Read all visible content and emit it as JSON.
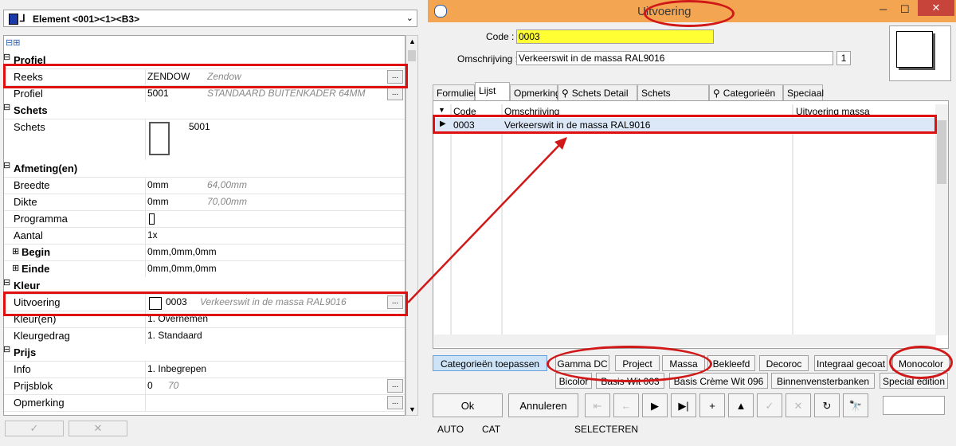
{
  "left": {
    "element_combo": "Element <001><1><B3>",
    "grid_header": "⊟⊞",
    "rows": [
      {
        "label": "Profiel",
        "kind": "cat"
      },
      {
        "label": "Reeks",
        "value": "ZENDOW",
        "hint": "Zendow",
        "btn": true
      },
      {
        "label": "Profiel",
        "value": "5001",
        "hint": "STANDAARD BUITENKADER 64MM",
        "btn": true
      },
      {
        "label": "Schets",
        "kind": "cat"
      },
      {
        "label": "Schets",
        "value": "5001"
      },
      {
        "label": "Afmeting(en)",
        "kind": "cat"
      },
      {
        "label": "Breedte",
        "value": "0mm",
        "hint": "64,00mm"
      },
      {
        "label": "Dikte",
        "value": "0mm",
        "hint": "70,00mm"
      },
      {
        "label": "Programma",
        "value": ""
      },
      {
        "label": "Aantal",
        "value": "1x"
      },
      {
        "label": "Begin",
        "value": "0mm,0mm,0mm"
      },
      {
        "label": "Einde",
        "value": "0mm,0mm,0mm"
      },
      {
        "label": "Kleur",
        "kind": "cat"
      },
      {
        "label": "Uitvoering",
        "value": "0003",
        "hint": "Verkeerswit in de massa RAL9016",
        "btn": true
      },
      {
        "label": "Kleur(en)",
        "value": "1. Overnemen"
      },
      {
        "label": "Kleurgedrag",
        "value": "1. Standaard"
      },
      {
        "label": "Prijs",
        "kind": "cat"
      },
      {
        "label": "Info",
        "value": "1. Inbegrepen"
      },
      {
        "label": "Prijsblok",
        "value": "0",
        "hint": "70",
        "btn": true
      },
      {
        "label": "Opmerking",
        "value": "",
        "btn": true
      }
    ],
    "bottom_ok": "✓",
    "bottom_cancel": "✕"
  },
  "window": {
    "title": "Uitvoering",
    "code_label": "Code :",
    "code_value": "0003",
    "omschrijving_label": "Omschrijving :",
    "omschrijving_value": "Verkeerswit in de massa RAL9016",
    "omschrijving_count": "1",
    "tabs": [
      "Formulier",
      "Lijst",
      "Opmerking",
      "Schets Detail",
      "Schets Overzicht",
      "Categorieën",
      "Speciaal"
    ],
    "columns": [
      "Code",
      "Omschrijving",
      "Uitvoering massa"
    ],
    "rows": [
      {
        "code": "0003",
        "omschrijving": "Verkeerswit in de massa RAL9016",
        "massa": ""
      }
    ],
    "apply_btn": "Categorieën toepassen",
    "cat_buttons_row1": [
      "Gamma DC",
      "Project",
      "Massa",
      "Bekleefd",
      "Decoroc",
      "Integraal gecoat",
      "Monocolor"
    ],
    "cat_buttons_row2": [
      "Bicolor",
      "Basis Wit 003",
      "Basis Crème Wit 096",
      "Binnenvensterbanken",
      "Special edition"
    ],
    "ok_btn": "Ok",
    "cancel_btn": "Annuleren",
    "nav_icons": [
      "⇤",
      "←",
      "▶",
      "▶|",
      "+",
      "▲",
      "✓",
      "✕",
      "↻",
      "🔭"
    ],
    "status": [
      "AUTO",
      "CAT",
      "SELECTEREN"
    ]
  },
  "colors": {
    "accent": "#f3a552",
    "highlight": "#e01010",
    "code_bg": "#ffff33"
  }
}
